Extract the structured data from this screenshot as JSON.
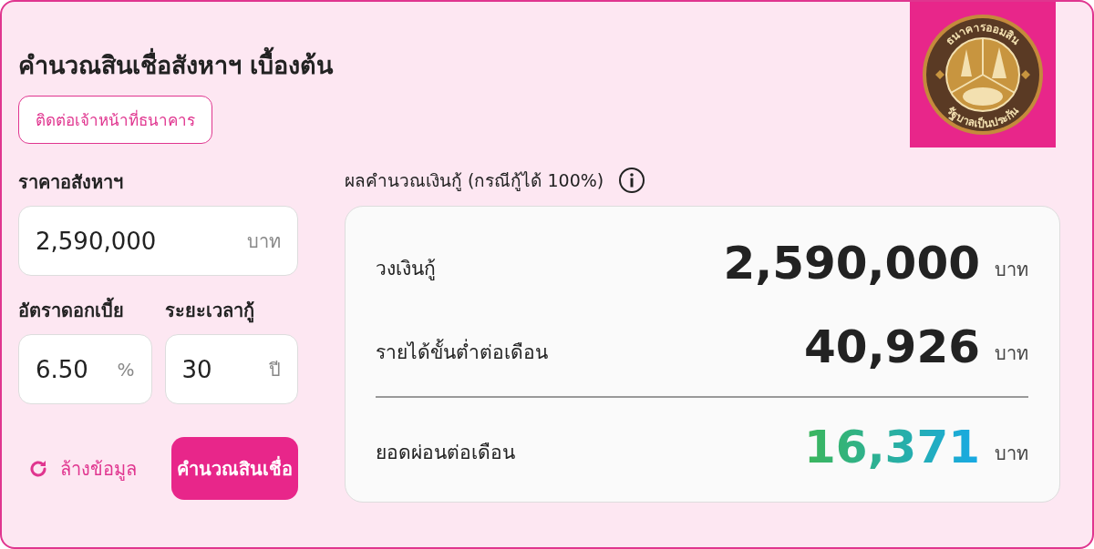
{
  "title": "คำนวณสินเชื่อสังหาฯ เบื้องต้น",
  "contact_button": "ติดต่อเจ้าหน้าที่ธนาคาร",
  "logo": {
    "top_text": "ธนาคารออมสิน",
    "bottom_text": "รัฐบาลเป็นประกัน"
  },
  "fields": [
    {
      "label": "ราคาอสังหาฯ",
      "value": "2,590,000",
      "unit": "บาท"
    },
    {
      "label": "อัตราดอกเบี้ย",
      "value": "6.50",
      "unit": "%"
    },
    {
      "label": "ระยะเวลากู้",
      "value": "30",
      "unit": "ปี"
    }
  ],
  "reset_button": "ล้างข้อมูล",
  "calculate_button": "คำนวณสินเชื่อ",
  "result": {
    "heading": "ผลคำนวณเงินกู้ (กรณีกู้ได้ 100%)",
    "rows": [
      {
        "kind": "plain",
        "label": "วงเงินกู้",
        "value": "2,590,000",
        "unit": "บาท"
      },
      {
        "kind": "plain",
        "label": "รายได้ขั้นต่ำต่อเดือน",
        "value": "40,926",
        "unit": "บาท"
      },
      {
        "kind": "highlight",
        "label": "ยอดผ่อนต่อเดือน",
        "value": "16,371",
        "unit": "บาท"
      }
    ]
  }
}
